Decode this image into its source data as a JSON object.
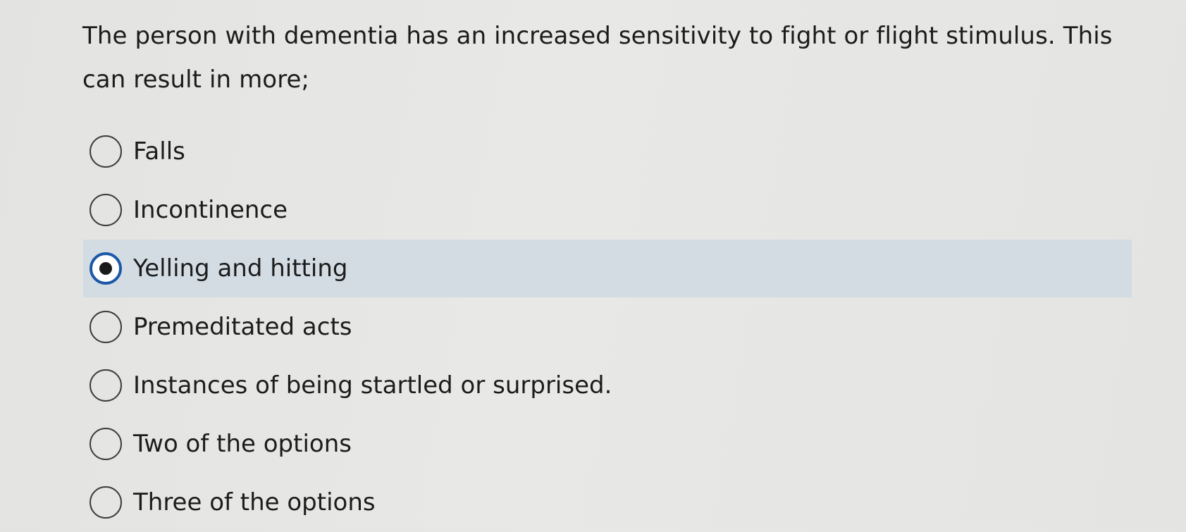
{
  "question": {
    "text": "The person with dementia has an increased sensitivity to fight or flight stimulus. This can result in more;"
  },
  "options": [
    {
      "label": "Falls",
      "selected": false
    },
    {
      "label": "Incontinence",
      "selected": false
    },
    {
      "label": "Yelling and hitting",
      "selected": true
    },
    {
      "label": "Premeditated acts",
      "selected": false
    },
    {
      "label": "Instances of being startled or surprised.",
      "selected": false
    },
    {
      "label": "Two of the options",
      "selected": false
    },
    {
      "label": "Three of the options",
      "selected": false
    }
  ],
  "colors": {
    "background": "#e6e6e4",
    "selected_highlight": "#d4dce3",
    "selected_radio_ring": "#1d58a8",
    "text": "#1c1c1c"
  },
  "icons": {
    "unselected": "radio-unchecked-icon",
    "selected": "radio-checked-icon"
  }
}
